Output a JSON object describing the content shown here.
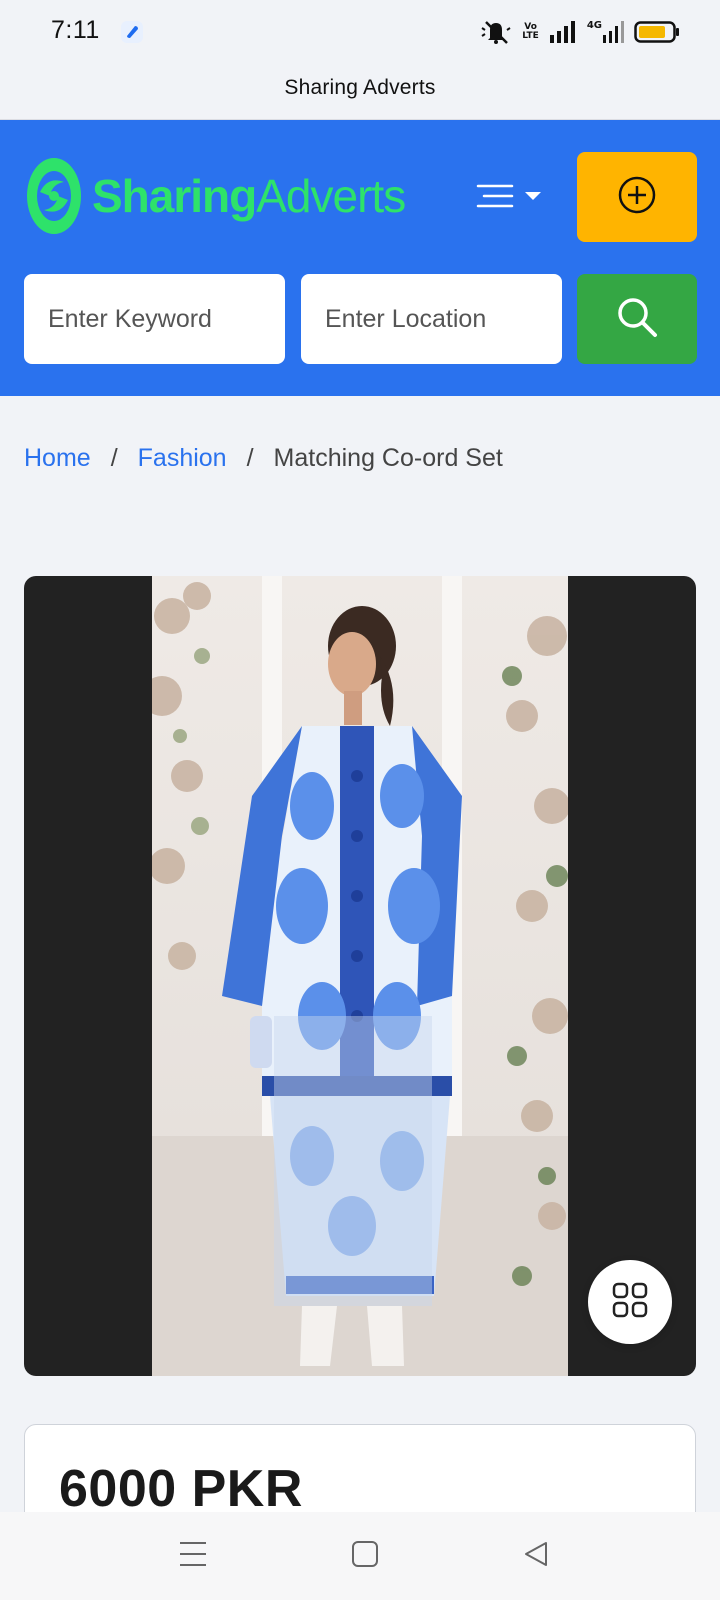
{
  "status_bar": {
    "time": "7:11",
    "volte_line1": "Vo",
    "volte_line2": "LTE",
    "network": "4G",
    "icons": [
      "app-icon",
      "mute-icon",
      "volte-icon",
      "signal-icon",
      "signal-4g-icon",
      "battery-icon"
    ]
  },
  "app": {
    "title": "Sharing Adverts"
  },
  "header": {
    "logo_bold": "Sharing",
    "logo_light": "Adverts",
    "brand_green": "#2ee26a",
    "header_blue": "#2a72ee",
    "post_button_color": "#ffb400",
    "search_button_color": "#34a744"
  },
  "search": {
    "keyword_placeholder": "Enter Keyword",
    "location_placeholder": "Enter Location"
  },
  "breadcrumb": {
    "home": "Home",
    "category": "Fashion",
    "current": "Matching Co-ord Set",
    "separator": "/"
  },
  "listing": {
    "price": "6000 PKR"
  }
}
